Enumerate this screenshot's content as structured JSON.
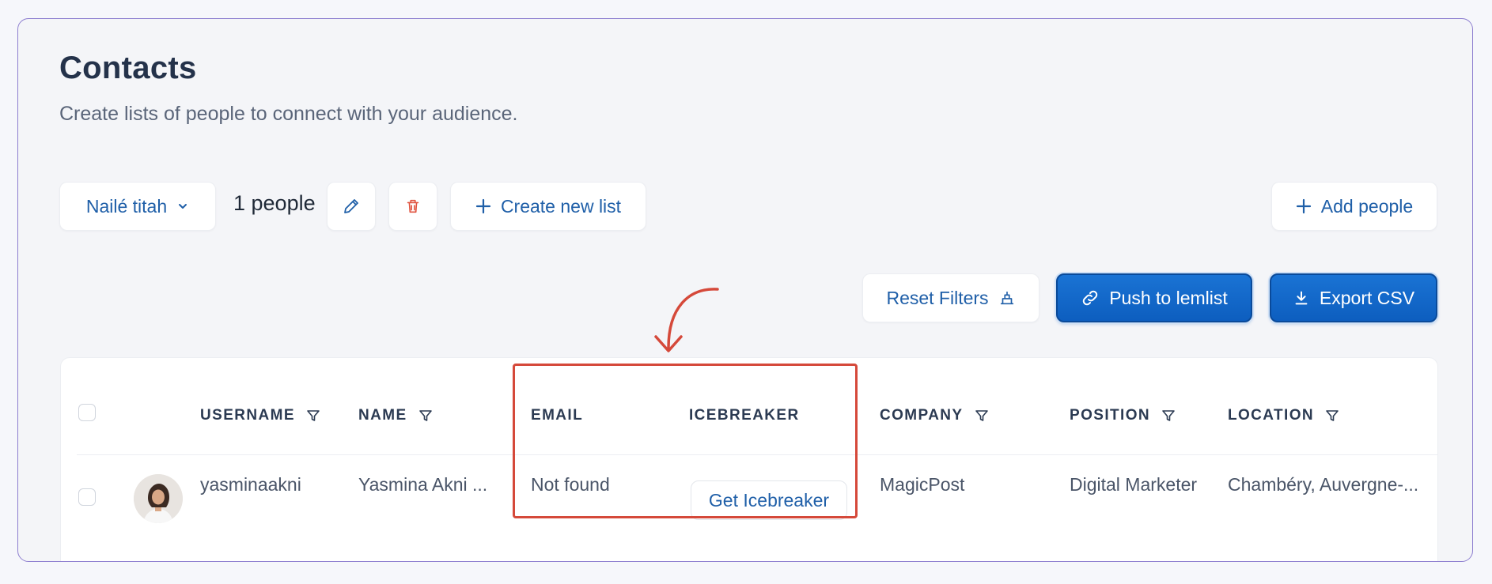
{
  "header": {
    "title": "Contacts",
    "subtitle": "Create lists of people to connect with your audience."
  },
  "toolbar": {
    "list_select_value": "Nailé titah",
    "people_count": "1 people",
    "create_list_label": "Create new list",
    "add_people_label": "Add people"
  },
  "actions": {
    "reset_filters_label": "Reset Filters",
    "push_label": "Push to lemlist",
    "export_label": "Export CSV"
  },
  "table": {
    "columns": [
      "USERNAME",
      "NAME",
      "EMAIL",
      "ICEBREAKER",
      "COMPANY",
      "POSITION",
      "LOCATION"
    ],
    "rows": [
      {
        "username": "yasminaakni",
        "name": "Yasmina Akni ...",
        "email": "Not found",
        "icebreaker_button": "Get Icebreaker",
        "company": "MagicPost",
        "position": "Digital Marketer",
        "location": "Chambéry, Auvergne-..."
      }
    ]
  },
  "colors": {
    "accent": "#1f5fa8",
    "primary_button": "#0d5ebf",
    "highlight": "#d5493a",
    "delete_icon": "#e0533f",
    "frame_border": "#8e7fd0"
  },
  "icons": [
    "chevron-down-icon",
    "pencil-icon",
    "trash-icon",
    "plus-icon",
    "filter-clear-icon",
    "link-icon",
    "download-icon",
    "filter-icon"
  ]
}
